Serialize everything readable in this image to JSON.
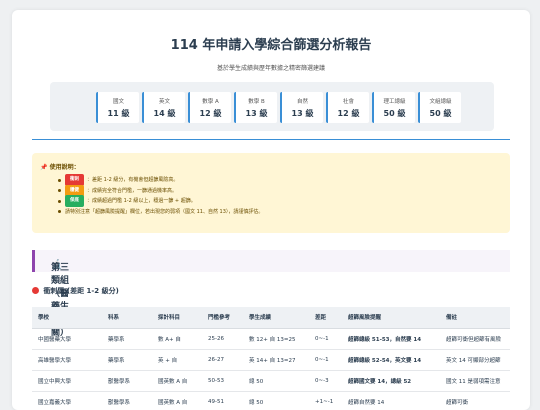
{
  "header": {
    "title": "114 年申請入學綜合篩選分析報告",
    "subtitle": "基於學生成績與歷年數據之精密篩選建議"
  },
  "scores": [
    {
      "name": "國文",
      "value": "11 級"
    },
    {
      "name": "英文",
      "value": "14 級"
    },
    {
      "name": "數學 A",
      "value": "12 級"
    },
    {
      "name": "數學 B",
      "value": "13 級"
    },
    {
      "name": "自然",
      "value": "13 級"
    },
    {
      "name": "社會",
      "value": "12 級"
    },
    {
      "name": "理工總級",
      "value": "50 級"
    },
    {
      "name": "文組總級",
      "value": "50 級"
    }
  ],
  "notice": {
    "title": "使用說明：",
    "items": [
      {
        "badge": "衝刺",
        "badge_color": "#e53935",
        "text": "：差距 1-2 級分，有機會但超篩風險高。"
      },
      {
        "badge": "穩健",
        "badge_color": "#f39c12",
        "text": "：成績完全符合門檻，一篩通過機率高。"
      },
      {
        "badge": "保底",
        "badge_color": "#27ae60",
        "text": "：成績超過門檻 1-2 級以上，穩過一篩 + 超篩。"
      },
      {
        "badge": "",
        "badge_color": "",
        "text": "請特別注意「超篩風險提醒」欄位，若出現您的弱項（國文 11、自然 13），請謹慎評估。"
      }
    ]
  },
  "section": {
    "icon": "🔬",
    "title": "第三類組（醫藥生物相關）"
  },
  "zone": {
    "label": "衝刺區 (差距 1-2 級分)"
  },
  "table": {
    "headers": [
      "學校",
      "科系",
      "採計科目",
      "門檻參考",
      "學生成績",
      "差距",
      "超篩風險提醒",
      "備註"
    ],
    "rows": [
      {
        "school": "中國醫藥大學",
        "dept": "藥學系",
        "subjects": "數 A+ 自",
        "threshold": "25-26",
        "student": "數 12+ 自 13=25",
        "gap": "0~-1",
        "risk": "超篩總級 51-53，自然要 14",
        "risk_hi": true,
        "note": "超篩可衝但超篩有風險"
      },
      {
        "school": "高雄醫學大學",
        "dept": "藥學系",
        "subjects": "英 + 自",
        "threshold": "26-27",
        "student": "英 14+ 自 13=27",
        "gap": "0~-1",
        "risk": "超篩總級 52-54，英文要 14",
        "risk_hi": true,
        "note": "英文 14 可顯部分超篩"
      },
      {
        "school": "國立中興大學",
        "dept": "獸醫學系",
        "subjects": "國英數 A 自",
        "threshold": "50-53",
        "student": "總 50",
        "gap": "0~-3",
        "risk": "超篩國文要 14，總級 52",
        "risk_hi": true,
        "note": "國文 11 是弱項需注意"
      },
      {
        "school": "國立嘉義大學",
        "dept": "獸醫學系",
        "subjects": "國英數 A 自",
        "threshold": "49-51",
        "student": "總 50",
        "gap": "+1~-1",
        "risk": "超篩自然要 14",
        "risk_hi": false,
        "note": "超篩可衝"
      }
    ]
  }
}
